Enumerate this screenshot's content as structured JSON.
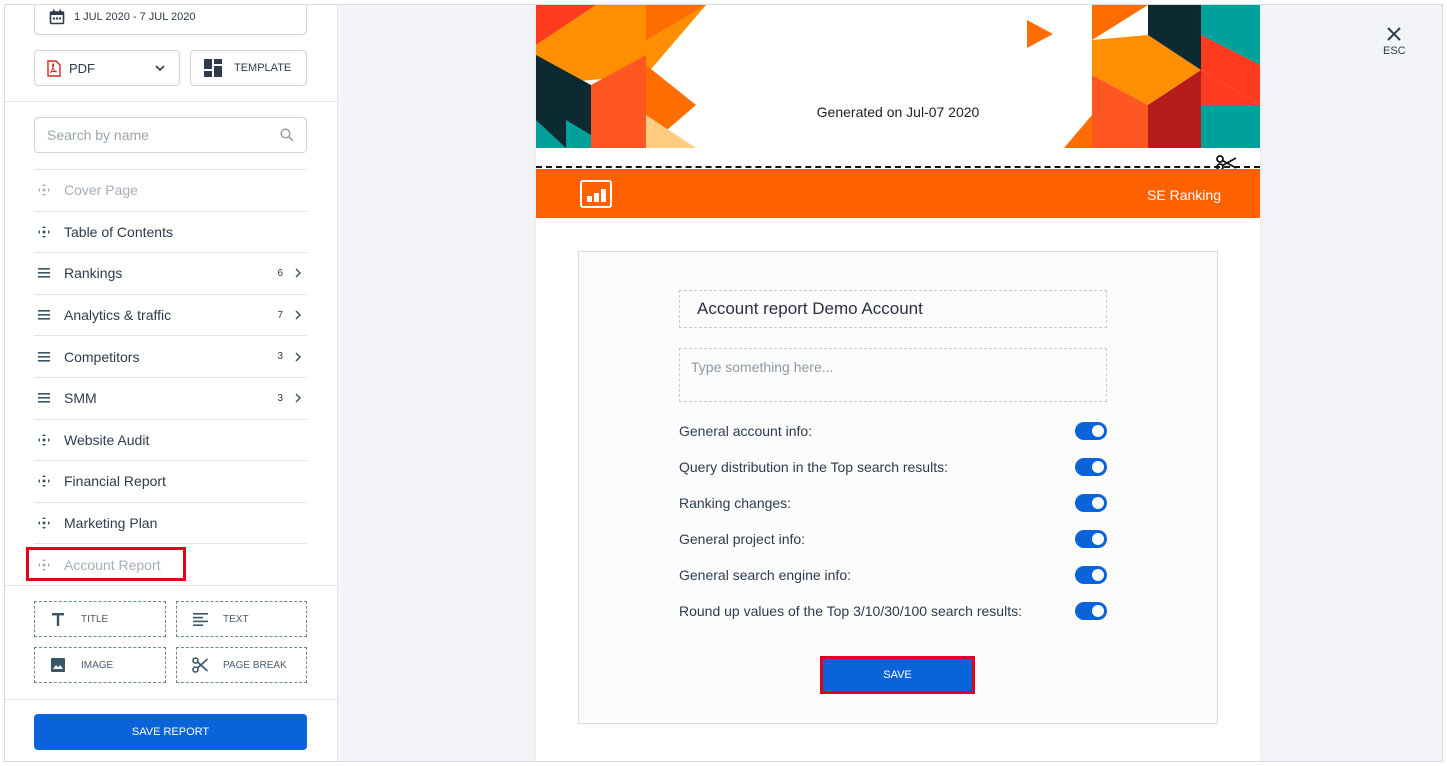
{
  "sidebar": {
    "date_range": "1 JUL 2020 - 7 JUL 2020",
    "format_select": "PDF",
    "template_label": "TEMPLATE",
    "search_placeholder": "Search by name",
    "items": [
      {
        "label": "Cover Page",
        "icon": "move-icon"
      },
      {
        "label": "Table of Contents",
        "icon": "move-icon"
      },
      {
        "label": "Rankings",
        "icon": "list-icon",
        "count": "6"
      },
      {
        "label": "Analytics & traffic",
        "icon": "list-icon",
        "count": "7"
      },
      {
        "label": "Competitors",
        "icon": "list-icon",
        "count": "3"
      },
      {
        "label": "SMM",
        "icon": "list-icon",
        "count": "3"
      },
      {
        "label": "Website Audit",
        "icon": "move-icon"
      },
      {
        "label": "Financial Report",
        "icon": "move-icon"
      },
      {
        "label": "Marketing Plan",
        "icon": "move-icon"
      },
      {
        "label": "Account Report",
        "icon": "move-icon"
      }
    ],
    "blocks": {
      "title": "TITLE",
      "text": "TEXT",
      "image": "IMAGE",
      "page_break": "PAGE BREAK"
    },
    "save_report": "SAVE REPORT"
  },
  "document": {
    "generated_on": "Generated on Jul-07 2020",
    "brand_name": "SE Ranking",
    "brand_color": "#ff6000"
  },
  "editor": {
    "title_value": "Account report Demo Account",
    "text_placeholder": "Type something here...",
    "options": [
      {
        "label": "General account info:",
        "on": true
      },
      {
        "label": "Query distribution in the Top search results:",
        "on": true
      },
      {
        "label": "Ranking changes:",
        "on": true
      },
      {
        "label": "General project info:",
        "on": true
      },
      {
        "label": "General search engine info:",
        "on": true
      },
      {
        "label": "Round up values of the Top 3/10/30/100 search results:",
        "on": true
      }
    ],
    "save_label": "SAVE"
  },
  "close": {
    "label": "ESC"
  },
  "colors": {
    "accent": "#0a63d8",
    "highlight": "#e0001b"
  }
}
